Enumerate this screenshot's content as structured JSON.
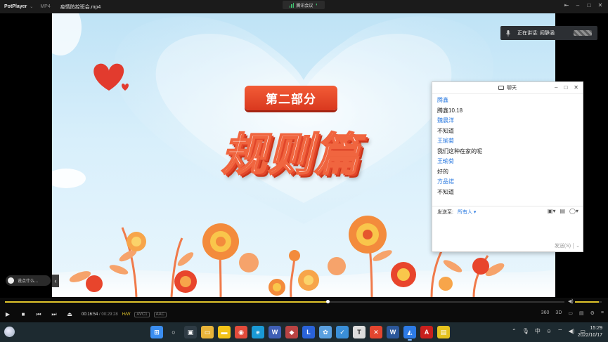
{
  "titlebar": {
    "app_name": "PotPlayer",
    "format": "MP4",
    "file_name": "疫情防控班会.mp4",
    "meeting_label": "腾讯会议",
    "window_controls": [
      "pin-icon",
      "minimize-icon",
      "maximize-icon",
      "close-icon"
    ]
  },
  "slide": {
    "tag": "第二部分",
    "title": "规则篇"
  },
  "speaking": {
    "label": "正在讲话: 阎静涵"
  },
  "chat": {
    "title": "聊天",
    "messages": [
      {
        "name": "腾鑫",
        "text": "腾鑫10.18"
      },
      {
        "name": "魏晨洋",
        "text": "不知道"
      },
      {
        "name": "王瑜菊",
        "text": "我们这种在家的呢"
      },
      {
        "name": "王瑜菊",
        "text": "好的"
      },
      {
        "name": "方品诺",
        "text": "不知道"
      }
    ],
    "send_to_label": "发送至:",
    "send_to_value": "所有人",
    "send_button": "发送(S)"
  },
  "left_pill": {
    "label": "说点什么..."
  },
  "player": {
    "progress": 0.577,
    "volume": 0.9,
    "time_current": "00:16:54",
    "time_separator": "/",
    "time_total": "00:29:28",
    "video_codec": "H/W",
    "audio_codec": "AVC1",
    "audio_format": "AAC",
    "right_controls": [
      "360",
      "3D",
      "subtitle-icon",
      "playlist-icon",
      "settings-icon",
      "menu-icon"
    ]
  },
  "taskbar": {
    "apps": [
      {
        "name": "start-icon",
        "color": "#3b8ef0",
        "glyph": "⊞"
      },
      {
        "name": "search-icon",
        "color": "transparent",
        "glyph": "○"
      },
      {
        "name": "taskview-icon",
        "color": "#2f3c45",
        "glyph": "▣"
      },
      {
        "name": "file-explorer-icon",
        "color": "#e8b43a",
        "glyph": "▭"
      },
      {
        "name": "sticky-notes-icon",
        "color": "#f2c318",
        "glyph": "▬"
      },
      {
        "name": "chrome-icon",
        "color": "#e24b3b",
        "glyph": "◉"
      },
      {
        "name": "edge-icon",
        "color": "#1a9ad6",
        "glyph": "e"
      },
      {
        "name": "word-icon-2",
        "color": "#3f5fb5",
        "glyph": "W"
      },
      {
        "name": "app-red-icon",
        "color": "#b94343",
        "glyph": "◆"
      },
      {
        "name": "app-blue-icon",
        "color": "#2a63d9",
        "glyph": "L"
      },
      {
        "name": "app-network-icon",
        "color": "#5aa0e0",
        "glyph": "✿"
      },
      {
        "name": "app-check-icon",
        "color": "#3a8fd8",
        "glyph": "✓"
      },
      {
        "name": "typora-icon",
        "color": "#dddddd",
        "glyph": "T"
      },
      {
        "name": "app-x-icon",
        "color": "#e2452f",
        "glyph": "✕"
      },
      {
        "name": "word-icon",
        "color": "#2b579a",
        "glyph": "W"
      },
      {
        "name": "tencent-meeting-icon",
        "color": "#2d7be6",
        "glyph": "◭"
      },
      {
        "name": "pdf-icon",
        "color": "#c8201d",
        "glyph": "A"
      },
      {
        "name": "notes-icon",
        "color": "#e5c21e",
        "glyph": "▤"
      }
    ],
    "ime": "中",
    "time": "15:29",
    "date": "2022/10/17"
  }
}
